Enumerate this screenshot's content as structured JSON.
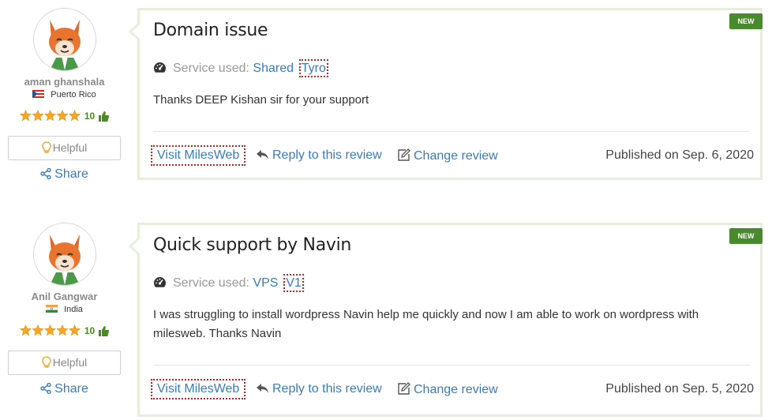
{
  "reviews": [
    {
      "user": {
        "name": "aman ghanshala",
        "country": "Puerto Rico",
        "flag": "puerto-rico-flag-icon",
        "rating": 5,
        "thumb_count": "10"
      },
      "helpful_label": "Helpful",
      "share_label": "Share",
      "badge": "NEW",
      "title": "Domain issue",
      "service_label": "Service used:",
      "service_type": "Shared",
      "service_sep": "·",
      "service_plan": "Tyro",
      "body": "Thanks DEEP Kishan sir for your support",
      "actions": {
        "visit": "Visit MilesWeb",
        "reply": "Reply to this review",
        "change": "Change review"
      },
      "published": "Published on Sep. 6, 2020"
    },
    {
      "user": {
        "name": "Anil Gangwar",
        "country": "India",
        "flag": "india-flag-icon",
        "rating": 5,
        "thumb_count": "10"
      },
      "helpful_label": "Helpful",
      "share_label": "Share",
      "badge": "NEW",
      "title": "Quick support by Navin",
      "service_label": "Service used:",
      "service_type": "VPS",
      "service_sep": "·",
      "service_plan": "V1",
      "body": "I was struggling to install wordpress Navin help me quickly and now I am able to work on wordpress with milesweb. Thanks Navin",
      "actions": {
        "visit": "Visit MilesWeb",
        "reply": "Reply to this review",
        "change": "Change review"
      },
      "published": "Published on Sep. 5, 2020"
    }
  ],
  "colors": {
    "link": "#3a7bbd",
    "badge": "#4a8a2e",
    "card_border": "#e5efdc",
    "stars": "#f5a623",
    "thumb": "#4a8a1f"
  }
}
